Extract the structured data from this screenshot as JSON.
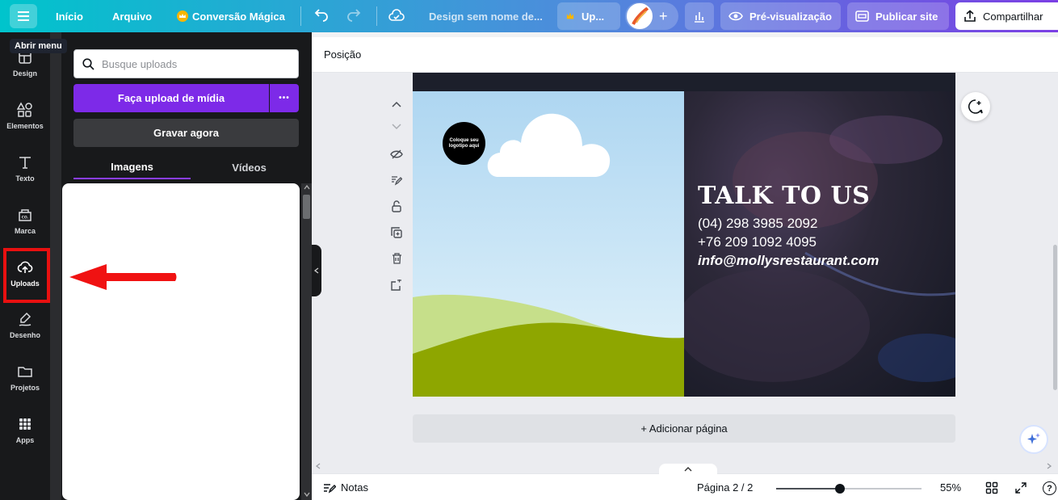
{
  "topbar": {
    "menu_tooltip": "Abrir menu",
    "home": "Início",
    "file": "Arquivo",
    "magic_convert": "Conversão Mágica",
    "design_name": "Design sem nome de...",
    "upgrade": "Up...",
    "add": "+",
    "preview": "Pré-visualização",
    "publish": "Publicar site",
    "share": "Compartilhar"
  },
  "rail": {
    "items": [
      {
        "label": "Design",
        "icon": "layout-icon"
      },
      {
        "label": "Elementos",
        "icon": "shapes-icon"
      },
      {
        "label": "Texto",
        "icon": "text-icon"
      },
      {
        "label": "Marca",
        "icon": "brand-icon"
      },
      {
        "label": "Uploads",
        "icon": "upload-cloud-icon"
      },
      {
        "label": "Desenho",
        "icon": "pen-icon"
      },
      {
        "label": "Projetos",
        "icon": "folder-icon"
      },
      {
        "label": "Apps",
        "icon": "apps-grid-icon"
      }
    ],
    "active": "Uploads"
  },
  "panel": {
    "search_placeholder": "Busque uploads",
    "upload_button": "Faça upload de mídia",
    "more": "•••",
    "record_button": "Gravar agora",
    "tabs": [
      {
        "label": "Imagens",
        "active": true
      },
      {
        "label": "Vídeos",
        "active": false
      }
    ]
  },
  "toolbar": {
    "position_label": "Posição"
  },
  "canvas": {
    "logo_placeholder": "Coloque seu logotipo aqui",
    "title": "TALK TO US",
    "phone1": "(04) 298 3985 2092",
    "phone2": "+76 209 1092 4095",
    "email": "info@mollysrestaurant.com"
  },
  "workspace": {
    "add_page": "+ Adicionar página"
  },
  "footer": {
    "notes": "Notas",
    "page_indicator": "Página 2 / 2",
    "zoom_label": "55%",
    "zoom_level": 0.44,
    "help": "?"
  },
  "colors": {
    "accent": "#7d2ae8",
    "highlight": "#e81010",
    "rail_bg": "#18191b"
  }
}
